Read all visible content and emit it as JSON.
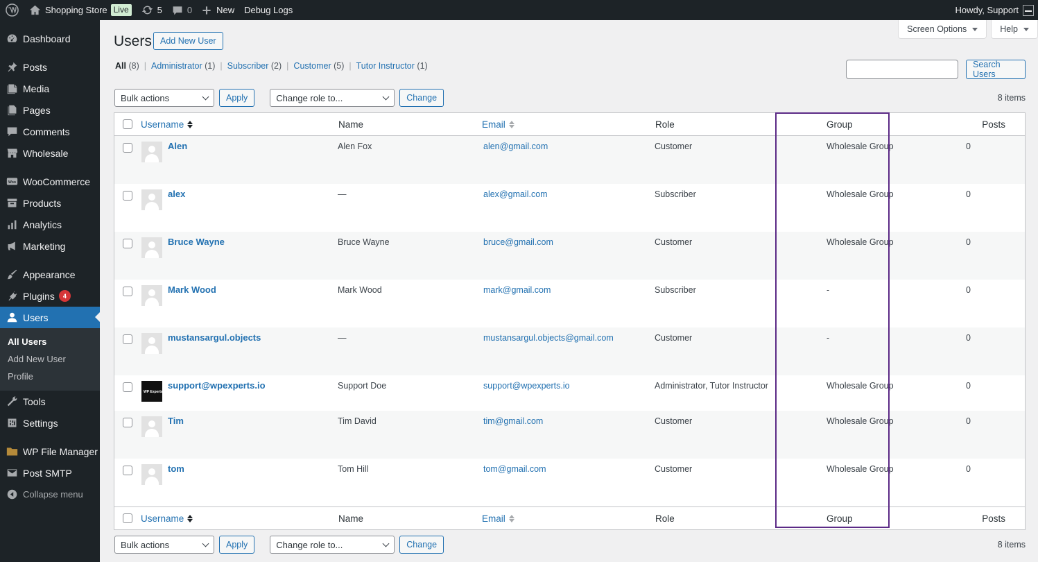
{
  "admin_bar": {
    "site_name": "Shopping Store",
    "live_label": "Live",
    "updates_count": "5",
    "comments_count": "0",
    "new_label": "New",
    "debug_label": "Debug Logs",
    "howdy": "Howdy, Support"
  },
  "sidebar": {
    "items": [
      {
        "label": "Dashboard",
        "icon": "dashboard-icon"
      },
      {
        "label": "Posts",
        "icon": "pin-icon"
      },
      {
        "label": "Media",
        "icon": "media-icon"
      },
      {
        "label": "Pages",
        "icon": "pages-icon"
      },
      {
        "label": "Comments",
        "icon": "comment-icon"
      },
      {
        "label": "Wholesale",
        "icon": "store-icon"
      },
      {
        "label": "WooCommerce",
        "icon": "woo-icon"
      },
      {
        "label": "Products",
        "icon": "archive-icon"
      },
      {
        "label": "Analytics",
        "icon": "bar-chart-icon"
      },
      {
        "label": "Marketing",
        "icon": "megaphone-icon"
      },
      {
        "label": "Appearance",
        "icon": "brush-icon"
      },
      {
        "label": "Plugins",
        "icon": "plug-icon",
        "badge": "4"
      },
      {
        "label": "Users",
        "icon": "user-icon"
      },
      {
        "label": "Tools",
        "icon": "wrench-icon"
      },
      {
        "label": "Settings",
        "icon": "settings-icon"
      },
      {
        "label": "WP File Manager",
        "icon": "folder-icon"
      },
      {
        "label": "Post SMTP",
        "icon": "email-icon"
      }
    ],
    "users_submenu": [
      "All Users",
      "Add New User",
      "Profile"
    ],
    "collapse_label": "Collapse menu"
  },
  "screen_options_label": "Screen Options",
  "help_label": "Help",
  "page_title": "Users",
  "add_new_label": "Add New User",
  "filters": [
    {
      "label": "All",
      "count": "(8)"
    },
    {
      "label": "Administrator",
      "count": "(1)"
    },
    {
      "label": "Subscriber",
      "count": "(2)"
    },
    {
      "label": "Customer",
      "count": "(5)"
    },
    {
      "label": "Tutor Instructor",
      "count": "(1)"
    }
  ],
  "search": {
    "value": "",
    "button": "Search Users"
  },
  "tablenav": {
    "bulk_actions": "Bulk actions",
    "apply": "Apply",
    "change_role": "Change role to...",
    "change": "Change",
    "items": "8 items"
  },
  "columns": {
    "username": "Username",
    "name": "Name",
    "email": "Email",
    "role": "Role",
    "group": "Group",
    "posts": "Posts"
  },
  "users": [
    {
      "username": "Alen",
      "name": "Alen Fox",
      "email": "alen@gmail.com",
      "role": "Customer",
      "group": "Wholesale Group",
      "posts": "0"
    },
    {
      "username": "alex",
      "name": "—",
      "email": "alex@gmail.com",
      "role": "Subscriber",
      "group": "Wholesale Group",
      "posts": "0"
    },
    {
      "username": "Bruce Wayne",
      "name": "Bruce Wayne",
      "email": "bruce@gmail.com",
      "role": "Customer",
      "group": "Wholesale Group",
      "posts": "0"
    },
    {
      "username": "Mark Wood",
      "name": "Mark Wood",
      "email": "mark@gmail.com",
      "role": "Subscriber",
      "group": "-",
      "posts": "0"
    },
    {
      "username": "mustansargul.objects",
      "name": "—",
      "email": "mustansargul.objects@gmail.com",
      "role": "Customer",
      "group": "-",
      "posts": "0"
    },
    {
      "username": "support@wpexperts.io",
      "name": "Support Doe",
      "email": "support@wpexperts.io",
      "role": "Administrator, Tutor Instructor",
      "group": "Wholesale Group",
      "posts": "0",
      "avatar_text": "WP Experts"
    },
    {
      "username": "Tim",
      "name": "Tim David",
      "email": "tim@gmail.com",
      "role": "Customer",
      "group": "Wholesale Group",
      "posts": "0"
    },
    {
      "username": "tom",
      "name": "Tom Hill",
      "email": "tom@gmail.com",
      "role": "Customer",
      "group": "Wholesale Group",
      "posts": "0"
    }
  ],
  "highlight_color": "#5b2a86"
}
